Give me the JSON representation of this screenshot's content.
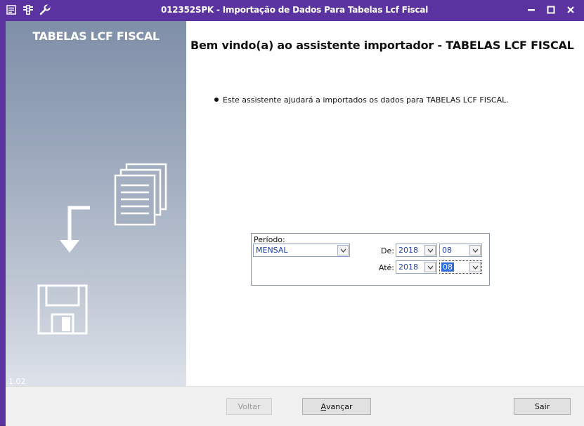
{
  "window": {
    "title": "012352SPK - Importação de Dados Para Tabelas Lcf Fiscal",
    "icons": [
      "menu-icon",
      "traffic-light-icon",
      "wrench-icon"
    ],
    "controls": [
      "minimize-icon",
      "maximize-icon",
      "close-icon"
    ]
  },
  "sidebar": {
    "title": "TABELAS LCF FISCAL",
    "version": "1.02"
  },
  "main": {
    "heading": "Bem vindo(a) ao assistente importador - TABELAS LCF FISCAL",
    "bullet": "Este assistente ajudará a importados os dados para TABELAS LCF FISCAL."
  },
  "periodo": {
    "label": "Período:",
    "type_value": "MENSAL",
    "de_label": "De:",
    "de_year": "2018",
    "de_month": "08",
    "ate_label": "Até:",
    "ate_year": "2018",
    "ate_month": "08"
  },
  "buttons": {
    "voltar": "Voltar",
    "avancar_prefix": "A",
    "avancar_rest": "vançar",
    "sair": "Sair"
  },
  "colors": {
    "frame": "#5b33a0",
    "value_text": "#1c3ea8",
    "selection": "#2f6ad9"
  }
}
